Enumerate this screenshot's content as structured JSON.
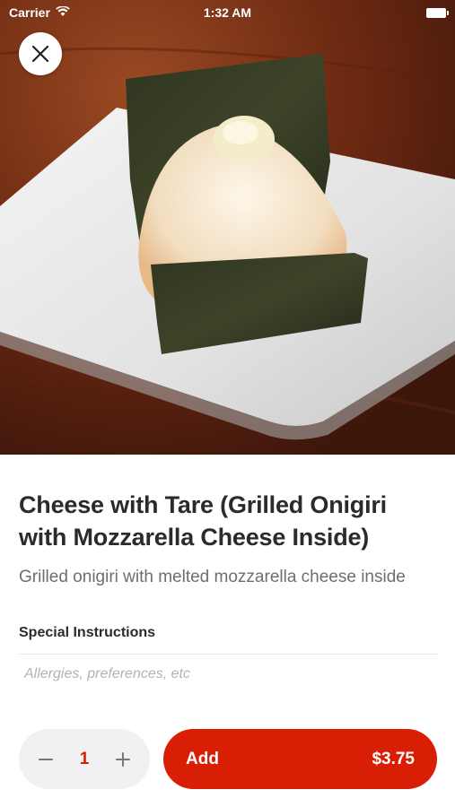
{
  "status_bar": {
    "carrier": "Carrier",
    "time": "1:32 AM"
  },
  "item": {
    "title": "Cheese with Tare (Grilled Onigiri with Mozzarella Cheese Inside)",
    "description": "Grilled onigiri with melted mozzarella cheese inside"
  },
  "special_instructions": {
    "label": "Special Instructions",
    "placeholder": "Allergies, preferences, etc",
    "value": ""
  },
  "quantity": {
    "value": "1",
    "decrement_icon": "minus-icon",
    "increment_icon": "plus-icon"
  },
  "add_button": {
    "label": "Add",
    "price": "$3.75"
  },
  "colors": {
    "accent": "#d81e05",
    "text_primary": "#2b2b2b",
    "text_secondary": "#6e6e6e",
    "placeholder": "#b3b3b3",
    "stepper_bg": "#f1f1f1"
  }
}
